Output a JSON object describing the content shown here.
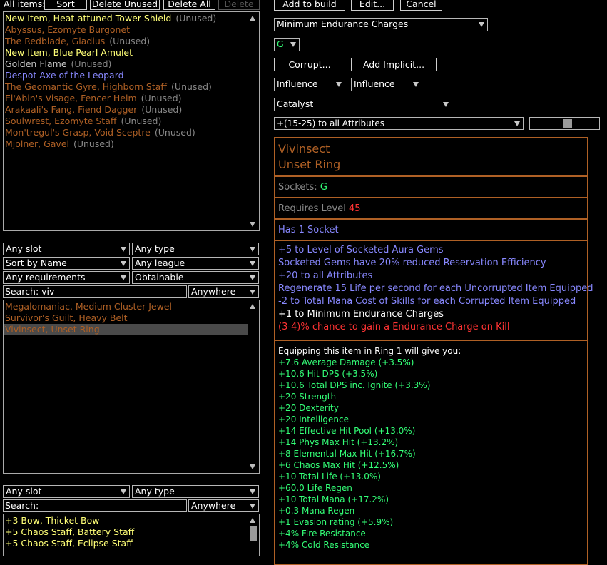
{
  "top_bar": {
    "all_items_label": "All items:",
    "sort": "Sort",
    "delete_unused": "Delete Unused",
    "delete_all": "Delete All",
    "delete": "Delete"
  },
  "all_items": [
    {
      "name": "New Item, Heat-attuned Tower Shield",
      "rarity": "rare",
      "tag": "(Unused)"
    },
    {
      "name": "Abyssus, Ezomyte Burgonet",
      "rarity": "unique",
      "tag": ""
    },
    {
      "name": "The Redblade, Gladius",
      "rarity": "unique",
      "tag": "(Unused)"
    },
    {
      "name": "New Item, Blue Pearl Amulet",
      "rarity": "rare",
      "tag": ""
    },
    {
      "name": "Golden Flame",
      "rarity": "normal",
      "tag": "(Unused)"
    },
    {
      "name": "Despot Axe of the Leopard",
      "rarity": "magic",
      "tag": ""
    },
    {
      "name": "The Geomantic Gyre, Highborn Staff",
      "rarity": "unique",
      "tag": "(Unused)"
    },
    {
      "name": "El'Abin's Visage, Fencer Helm",
      "rarity": "unique",
      "tag": "(Unused)"
    },
    {
      "name": "Arakaali's Fang, Fiend Dagger",
      "rarity": "unique",
      "tag": "(Unused)"
    },
    {
      "name": "Soulwrest, Ezomyte Staff",
      "rarity": "unique",
      "tag": "(Unused)"
    },
    {
      "name": "Mon'tregul's Grasp, Void Sceptre",
      "rarity": "unique",
      "tag": "(Unused)"
    },
    {
      "name": "Mjolner, Gavel",
      "rarity": "unique",
      "tag": "(Unused)"
    }
  ],
  "filters1": {
    "slot": "Any slot",
    "type": "Any type",
    "sort": "Sort by Name",
    "league": "Any league",
    "requirements": "Any requirements",
    "obtainable": "Obtainable",
    "search_label": "Search:",
    "search_value": "viv",
    "scope": "Anywhere"
  },
  "db_results": [
    {
      "name": "Megalomaniac, Medium Cluster Jewel",
      "rarity": "unique"
    },
    {
      "name": "Survivor's Guilt, Heavy Belt",
      "rarity": "unique"
    },
    {
      "name": "Vivinsect, Unset Ring",
      "rarity": "unique",
      "selected": true
    }
  ],
  "filters2": {
    "slot": "Any slot",
    "type": "Any type",
    "search_label": "Search:",
    "search_value": "",
    "scope": "Anywhere"
  },
  "bottom_list": [
    {
      "name": "+3 Bow, Thicket Bow",
      "rarity": "rare"
    },
    {
      "name": "+5 Chaos Staff, Battery Staff",
      "rarity": "rare"
    },
    {
      "name": "+5 Chaos Staff, Eclipse Staff",
      "rarity": "rare"
    }
  ],
  "edit": {
    "add_to_build": "Add to build",
    "edit": "Edit...",
    "cancel": "Cancel",
    "variant": "Minimum Endurance Charges",
    "socket": "G",
    "corrupt": "Corrupt...",
    "add_implicit": "Add Implicit...",
    "influence1": "Influence",
    "influence2": "Influence",
    "catalyst": "Catalyst",
    "catalyst_mod": "+(15-25) to all Attributes",
    "catalyst_quality_fraction": 0.55
  },
  "tooltip": {
    "name": "Vivinsect",
    "base": "Unset Ring",
    "sockets_label": "Sockets:",
    "sockets_value": "G",
    "req_label": "Requires Level",
    "req_value": "45",
    "implicit": "Has 1 Socket",
    "mods": [
      {
        "text": "+5 to Level of Socketed Aura Gems",
        "kind": "magic"
      },
      {
        "text": "Socketed Gems have 20% reduced Reservation Efficiency",
        "kind": "magic"
      },
      {
        "text": "+20 to all Attributes",
        "kind": "magic"
      },
      {
        "text": "Regenerate 15 Life per second for each Uncorrupted Item Equipped",
        "kind": "magic"
      },
      {
        "text": "-2 to Total Mana Cost of Skills for each Corrupted Item Equipped",
        "kind": "magic"
      },
      {
        "text": "+1 to Minimum Endurance Charges",
        "kind": "white"
      },
      {
        "text": "(3-4)% chance to gain a Endurance Charge on Kill",
        "kind": "red"
      }
    ],
    "compare_header": "Equipping this item in Ring 1 will give you:",
    "compare_lines": [
      "+7.6 Average Damage (+3.5%)",
      "+10.6 Hit DPS (+3.5%)",
      "+10.6 Total DPS inc. Ignite (+3.3%)",
      "+20 Strength",
      "+20 Dexterity",
      "+20 Intelligence",
      "+14 Effective Hit Pool (+13.0%)",
      "+14 Phys Max Hit (+13.2%)",
      "+8 Elemental Max Hit (+16.7%)",
      "+6 Chaos Max Hit (+12.5%)",
      "+10 Total Life (+13.0%)",
      "+60.0 Life Regen",
      "+10 Total Mana (+17.2%)",
      "+0.3 Mana Regen",
      "+1 Evasion rating (+5.9%)",
      "+4% Fire Resistance",
      "+4% Cold Resistance"
    ]
  },
  "colors": {
    "unique": "#af6025",
    "rare": "#ffff77",
    "magic": "#8888ff",
    "normal": "#c8c8c8",
    "gem_green": "#33ff77",
    "req_red": "#ff3333"
  }
}
